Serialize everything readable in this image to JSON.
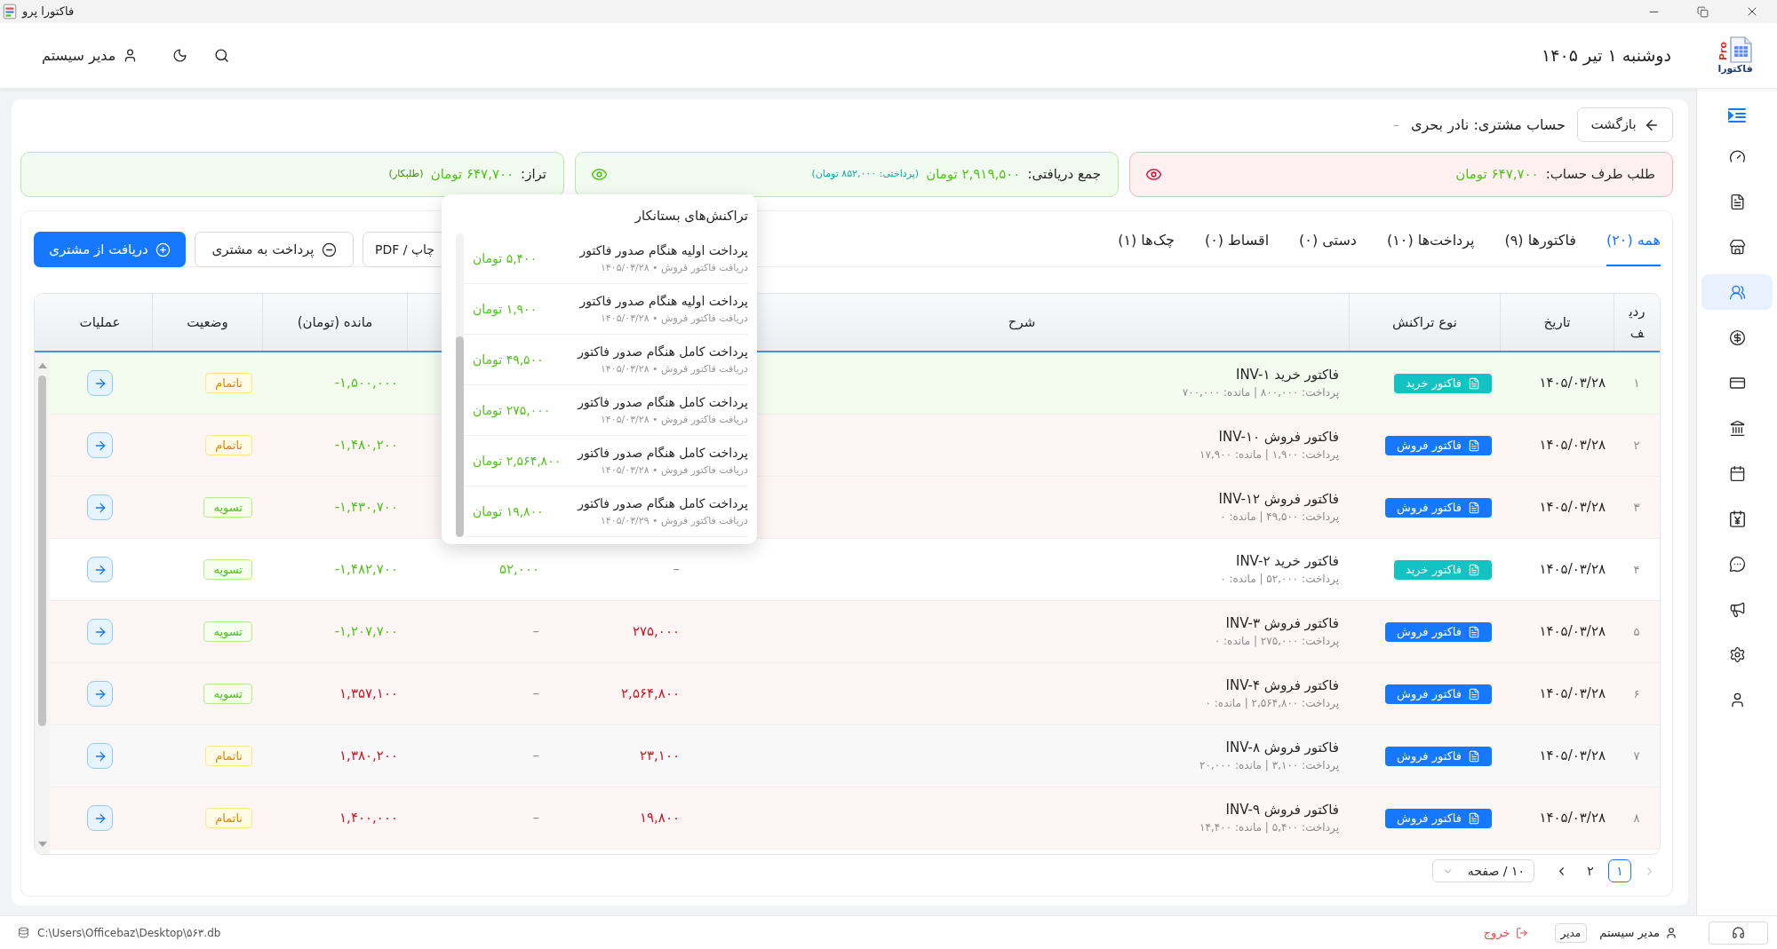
{
  "window": {
    "title": "فاکتورا پرو"
  },
  "header": {
    "logo": {
      "mark": "Pro",
      "name": "فاکتورا"
    },
    "date": "دوشنبه ۱ تیر ۱۴۰۵",
    "user": "مدیر سیستم"
  },
  "sidebar": {
    "items": [
      {
        "kind": "dashboard",
        "selected": false
      },
      {
        "kind": "invoices",
        "selected": false
      },
      {
        "kind": "store",
        "selected": false
      },
      {
        "kind": "customers",
        "selected": true
      },
      {
        "kind": "payments",
        "selected": false
      },
      {
        "kind": "cards",
        "selected": false
      },
      {
        "kind": "bank",
        "selected": false
      },
      {
        "kind": "calendar",
        "selected": false
      },
      {
        "kind": "installments",
        "selected": false
      },
      {
        "kind": "messages",
        "selected": false
      },
      {
        "kind": "campaigns",
        "selected": false
      },
      {
        "kind": "settings",
        "selected": false
      },
      {
        "kind": "users",
        "selected": false
      }
    ]
  },
  "account": {
    "back_button": "بازگشت",
    "title": "حساب مشتری: نادر بحری",
    "detail": "–"
  },
  "summary_cards": [
    {
      "kind": "receivable",
      "label": "طلب طرف حساب:",
      "amount": "۶۴۷,۷۰۰ تومان",
      "details_button": true
    },
    {
      "kind": "received",
      "label": "جمع دریافتی:",
      "amount": "۲,۹۱۹,۵۰۰ تومان",
      "note": "(پرداختی: ۸۵۲,۰۰۰ تومان)",
      "details_button": true
    },
    {
      "kind": "balance",
      "label": "تراز:",
      "amount": "۶۴۷,۷۰۰ تومان",
      "note": "(طلبکار)",
      "details_button": false
    }
  ],
  "tabs": [
    {
      "label": "همه (۲۰)",
      "selected": true
    },
    {
      "label": "فاکتورها (۹)",
      "selected": false
    },
    {
      "label": "پرداخت‌ها (۱۰)",
      "selected": false
    },
    {
      "label": "دستی (۰)",
      "selected": false
    },
    {
      "label": "اقساط (۰)",
      "selected": false
    },
    {
      "label": "چک‌ها (۱)",
      "selected": false
    }
  ],
  "actions": [
    {
      "kind": "print",
      "label": "چاپ / PDF"
    },
    {
      "kind": "secondary",
      "label": "پرداخت به مشتری"
    },
    {
      "kind": "primary",
      "label": "دریافت از مشتری"
    }
  ],
  "table": {
    "columns": {
      "row": "ردیف",
      "date": "تاریخ",
      "type": "نوع تراکنش",
      "description": "شرح",
      "balance": "مانده (تومان)",
      "status": "وضعیت",
      "actions": "عملیات"
    },
    "rows": [
      {
        "index": "۱",
        "color": "#f3fcef",
        "date": "۱۴۰۵/۰۳/۲۸",
        "type": {
          "label": "فاکتور خرید",
          "color": "#13c2c2"
        },
        "title": "فاکتور خرید INV-۱",
        "subtitle": "پرداخت: ۸۰۰,۰۰۰ | مانده: ۷۰۰,۰۰۰",
        "balance": "-۱,۵۰۰,۰۰۰",
        "balance_debit": false,
        "status": "ناتمام",
        "settled": false
      },
      {
        "index": "۲",
        "color": "#fdf6f5",
        "date": "۱۴۰۵/۰۳/۲۸",
        "type": {
          "label": "فاکتور فروش",
          "color": "#1677ff"
        },
        "title": "فاکتور فروش INV-۱۰",
        "subtitle": "پرداخت: ۱,۹۰۰ | مانده: ۱۷,۹۰۰",
        "balance": "-۱,۴۸۰,۲۰۰",
        "balance_debit": false,
        "status": "ناتمام",
        "settled": false
      },
      {
        "index": "۳",
        "color": "#fdf6f5",
        "date": "۱۴۰۵/۰۳/۲۸",
        "type": {
          "label": "فاکتور فروش",
          "color": "#1677ff"
        },
        "title": "فاکتور فروش INV-۱۲",
        "subtitle": "پرداخت: ۴۹,۵۰۰ | مانده: ۰",
        "balance": "-۱,۴۳۰,۷۰۰",
        "balance_debit": false,
        "status": "تسویه",
        "settled": true
      },
      {
        "index": "۴",
        "color": "#ffffff",
        "date": "۱۴۰۵/۰۳/۲۸",
        "type": {
          "label": "فاکتور خرید",
          "color": "#13c2c2"
        },
        "title": "فاکتور خرید INV-۲",
        "subtitle": "پرداخت: ۵۲,۰۰۰ | مانده: ۰",
        "column_5": {
          "kind": "blank",
          "text": "–"
        },
        "column_6": {
          "kind": "amount",
          "text": "۵۲,۰۰۰"
        },
        "balance": "-۱,۴۸۲,۷۰۰",
        "balance_debit": false,
        "status": "تسویه",
        "settled": true
      },
      {
        "index": "۵",
        "color": "#fdf6f5",
        "date": "۱۴۰۵/۰۳/۲۸",
        "type": {
          "label": "فاکتور فروش",
          "color": "#1677ff"
        },
        "title": "فاکتور فروش INV-۳",
        "subtitle": "پرداخت: ۲۷۵,۰۰۰ | مانده: ۰",
        "column_5": {
          "kind": "amount",
          "text": "۲۷۵,۰۰۰"
        },
        "column_6": {
          "kind": "blank",
          "text": "–"
        },
        "balance": "-۱,۲۰۷,۷۰۰",
        "balance_debit": false,
        "status": "تسویه",
        "settled": true
      },
      {
        "index": "۶",
        "color": "#fdf6f5",
        "date": "۱۴۰۵/۰۳/۲۸",
        "type": {
          "label": "فاکتور فروش",
          "color": "#1677ff"
        },
        "title": "فاکتور فروش INV-۴",
        "subtitle": "پرداخت: ۲,۵۶۴,۸۰۰ | مانده: ۰",
        "column_5": {
          "kind": "amount",
          "text": "۲,۵۶۴,۸۰۰"
        },
        "column_6": {
          "kind": "blank",
          "text": "–"
        },
        "balance": "۱,۳۵۷,۱۰۰",
        "balance_debit": true,
        "status": "تسویه",
        "settled": true
      },
      {
        "index": "۷",
        "color": "#f8f8f8",
        "date": "۱۴۰۵/۰۳/۲۸",
        "type": {
          "label": "فاکتور فروش",
          "color": "#1677ff"
        },
        "title": "فاکتور فروش INV-۸",
        "subtitle": "پرداخت: ۳,۱۰۰ | مانده: ۲۰,۰۰۰",
        "column_5": {
          "kind": "amount",
          "text": "۲۳,۱۰۰"
        },
        "column_6": {
          "kind": "blank",
          "text": "–"
        },
        "balance": "۱,۳۸۰,۲۰۰",
        "balance_debit": true,
        "status": "ناتمام",
        "settled": false
      },
      {
        "index": "۸",
        "color": "#fdf6f5",
        "date": "۱۴۰۵/۰۳/۲۸",
        "type": {
          "label": "فاکتور فروش",
          "color": "#1677ff"
        },
        "title": "فاکتور فروش INV-۹",
        "subtitle": "پرداخت: ۵,۴۰۰ | مانده: ۱۴,۴۰۰",
        "column_5": {
          "kind": "amount",
          "text": "۱۹,۸۰۰"
        },
        "column_6": {
          "kind": "blank",
          "text": "–"
        },
        "balance": "۱,۴۰۰,۰۰۰",
        "balance_debit": true,
        "status": "ناتمام",
        "settled": false
      }
    ]
  },
  "pagination": {
    "previous_disabled": true,
    "next_disabled": false,
    "pages": [
      {
        "label": "۱",
        "selected": true
      },
      {
        "label": "۲",
        "selected": false
      }
    ],
    "page_size": "۱۰ / صفحه"
  },
  "popover": {
    "title": "تراکنش‌های بستانکار",
    "items": [
      {
        "title": "پرداخت اولیه هنگام صدور فاکتور",
        "meta": "دریافت فاکتور فروش • ۱۴۰۵/۰۳/۲۸",
        "amount": "۵,۴۰۰ تومان"
      },
      {
        "title": "پرداخت اولیه هنگام صدور فاکتور",
        "meta": "دریافت فاکتور فروش • ۱۴۰۵/۰۳/۲۸",
        "amount": "۱,۹۰۰ تومان"
      },
      {
        "title": "پرداخت کامل هنگام صدور فاکتور",
        "meta": "دریافت فاکتور فروش • ۱۴۰۵/۰۳/۲۸",
        "amount": "۴۹,۵۰۰ تومان"
      },
      {
        "title": "پرداخت کامل هنگام صدور فاکتور",
        "meta": "دریافت فاکتور فروش • ۱۴۰۵/۰۳/۲۸",
        "amount": "۲۷۵,۰۰۰ تومان"
      },
      {
        "title": "پرداخت کامل هنگام صدور فاکتور",
        "meta": "دریافت فاکتور فروش • ۱۴۰۵/۰۳/۲۸",
        "amount": "۲,۵۶۴,۸۰۰ تومان"
      },
      {
        "title": "پرداخت کامل هنگام صدور فاکتور",
        "meta": "دریافت فاکتور فروش • ۱۴۰۵/۰۳/۲۹",
        "amount": "۱۹,۸۰۰ تومان"
      }
    ]
  },
  "status_bar": {
    "path": "C:\\Users\\Officebaz\\Desktop\\۵۶۳.db",
    "user": "مدیر سیستم",
    "role": "مدیر",
    "logout": "خروج"
  }
}
